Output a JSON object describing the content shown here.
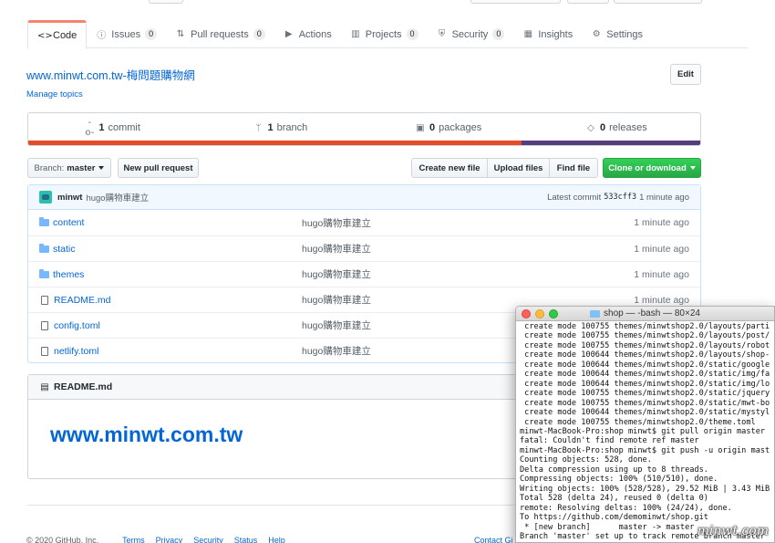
{
  "tabs": [
    {
      "icon": "code-icon",
      "glyph": "<>",
      "label": "Code",
      "count": ""
    },
    {
      "icon": "issue-icon",
      "glyph": "ⓘ",
      "label": "Issues",
      "count": "0"
    },
    {
      "icon": "pull-request-icon",
      "glyph": "⇅",
      "label": "Pull requests",
      "count": "0"
    },
    {
      "icon": "actions-icon",
      "glyph": "▶",
      "label": "Actions",
      "count": ""
    },
    {
      "icon": "projects-icon",
      "glyph": "▥",
      "label": "Projects",
      "count": "0"
    },
    {
      "icon": "security-icon",
      "glyph": "⛨",
      "label": "Security",
      "count": "0"
    },
    {
      "icon": "insights-icon",
      "glyph": "▦",
      "label": "Insights",
      "count": ""
    },
    {
      "icon": "settings-icon",
      "glyph": "⚙",
      "label": "Settings",
      "count": ""
    }
  ],
  "repo": {
    "description": "www.minwt.com.tw-梅問題購物網",
    "manage_topics": "Manage topics",
    "edit_label": "Edit"
  },
  "summary": {
    "commits_num": "1",
    "commits_label": "commit",
    "branches_num": "1",
    "branches_label": "branch",
    "packages_num": "0",
    "packages_label": "packages",
    "releases_num": "0",
    "releases_label": "releases",
    "language_share": {
      "first": 0.734,
      "second": 0.266
    },
    "language_colors": {
      "first": "#e34c26",
      "second": "#563d7c"
    }
  },
  "toolbar": {
    "branch_prefix": "Branch:",
    "branch_name": "master",
    "new_pr": "New pull request",
    "create_file": "Create new file",
    "upload_files": "Upload files",
    "find_file": "Find file",
    "clone": "Clone or download"
  },
  "commit": {
    "author": "minwt",
    "message": "hugo購物車建立",
    "latest_label": "Latest commit",
    "sha": "533cff3",
    "time": "1 minute ago"
  },
  "files": [
    {
      "type": "dir",
      "name": "content",
      "message": "hugo購物車建立",
      "age": "1 minute ago"
    },
    {
      "type": "dir",
      "name": "static",
      "message": "hugo購物車建立",
      "age": "1 minute ago"
    },
    {
      "type": "dir",
      "name": "themes",
      "message": "hugo購物車建立",
      "age": "1 minute ago"
    },
    {
      "type": "file",
      "name": "README.md",
      "message": "hugo購物車建立",
      "age": "1 minute ago"
    },
    {
      "type": "file",
      "name": "config.toml",
      "message": "hugo購物車建立",
      "age": ""
    },
    {
      "type": "file",
      "name": "netlify.toml",
      "message": "hugo購物車建立",
      "age": ""
    }
  ],
  "readme": {
    "title": "README.md",
    "heading": "www.minwt.com.tw"
  },
  "footer": {
    "copyright": "© 2020 GitHub, Inc.",
    "links": [
      "Terms",
      "Privacy",
      "Security",
      "Status",
      "Help"
    ],
    "contact": "Contact Gi"
  },
  "terminal": {
    "title": "shop — -bash — 80×24",
    "lines": [
      " create mode 100755 themes/minwtshop2.0/layouts/parti",
      " create mode 100755 themes/minwtshop2.0/layouts/post/",
      " create mode 100755 themes/minwtshop2.0/layouts/robot",
      " create mode 100644 themes/minwtshop2.0/layouts/shop-",
      " create mode 100644 themes/minwtshop2.0/static/google",
      " create mode 100644 themes/minwtshop2.0/static/img/fa",
      " create mode 100644 themes/minwtshop2.0/static/img/lo",
      " create mode 100755 themes/minwtshop2.0/static/jquery",
      " create mode 100755 themes/minwtshop2.0/static/mwt-bo",
      " create mode 100644 themes/minwtshop2.0/static/mystyl",
      " create mode 100755 themes/minwtshop2.0/theme.toml",
      "minwt-MacBook-Pro:shop minwt$ git pull origin master",
      "fatal: Couldn't find remote ref master",
      "minwt-MacBook-Pro:shop minwt$ git push -u origin mast",
      "Counting objects: 528, done.",
      "Delta compression using up to 8 threads.",
      "Compressing objects: 100% (510/510), done.",
      "Writing objects: 100% (528/528), 29.52 MiB | 3.43 MiB",
      "Total 528 (delta 24), reused 0 (delta 0)",
      "remote: Resolving deltas: 100% (24/24), done.",
      "To https://github.com/demominwt/shop.git",
      " * [new branch]      master -> master",
      "Branch 'master' set up to track remote branch master"
    ],
    "watermark": "minwt.com"
  }
}
